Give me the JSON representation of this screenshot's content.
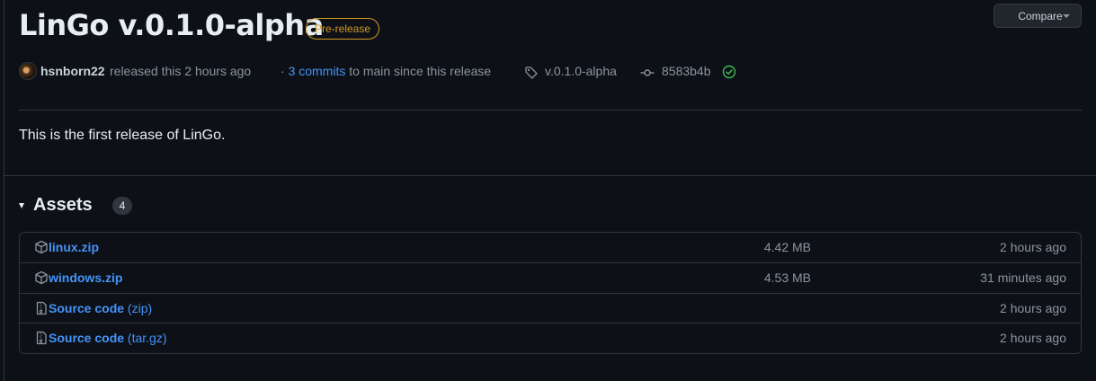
{
  "release": {
    "title": "LinGo v.0.1.0-alpha",
    "badge": "Pre-release",
    "author": "hsnborn22",
    "released_text": "released this 2 hours ago",
    "commits_prefix": "·",
    "commits_link": "3 commits",
    "commits_suffix": "to main since this release",
    "tag": "v.0.1.0-alpha",
    "commit_sha": "8583b4b",
    "body": "This is the first release of LinGo."
  },
  "toolbar": {
    "compare_label": "Compare"
  },
  "assets": {
    "title": "Assets",
    "count": "4",
    "items": [
      {
        "name": "linux.zip",
        "sub": "",
        "size": "4.42 MB",
        "time": "2 hours ago",
        "icon": "package-icon"
      },
      {
        "name": "windows.zip",
        "sub": "",
        "size": "4.53 MB",
        "time": "31 minutes ago",
        "icon": "package-icon"
      },
      {
        "name": "Source code",
        "sub": "(zip)",
        "size": "",
        "time": "2 hours ago",
        "icon": "file-zip-icon"
      },
      {
        "name": "Source code",
        "sub": "(tar.gz)",
        "size": "",
        "time": "2 hours ago",
        "icon": "file-zip-icon"
      }
    ]
  },
  "colors": {
    "accent": "#4493f8",
    "prerelease": "#d29922",
    "success": "#3fb950",
    "background": "#0d1117"
  }
}
